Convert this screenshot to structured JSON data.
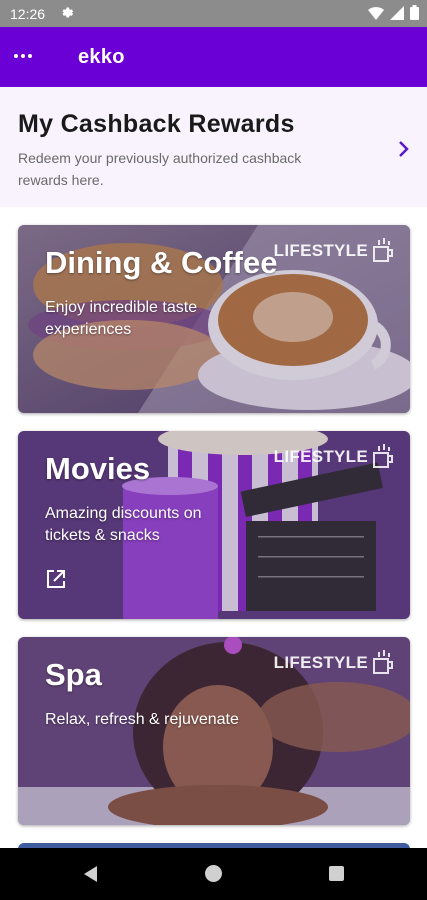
{
  "status_bar": {
    "time": "12:26",
    "icons": [
      "gear-icon",
      "wifi-icon",
      "signal-icon",
      "battery-icon"
    ]
  },
  "app_bar": {
    "title": "ekko",
    "menu_icon": "more-horizontal-icon",
    "color": "#6b00d6"
  },
  "cashback": {
    "title": "My Cashback Rewards",
    "description": "Redeem your previously authorized cashback rewards here.",
    "chevron_icon": "chevron-right-icon",
    "accent": "#5a18c9"
  },
  "cards": [
    {
      "title": "Dining & Coffee",
      "subtitle": "Enjoy incredible taste experiences",
      "badge": "LIFESTYLE"
    },
    {
      "title": "Movies",
      "subtitle": "Amazing discounts on tickets & snacks",
      "badge": "LIFESTYLE",
      "icon": "external-link-icon"
    },
    {
      "title": "Spa",
      "subtitle": "Relax, refresh & rejuvenate",
      "badge": "LIFESTYLE"
    }
  ],
  "nav_bar": {
    "icons": [
      "back-icon",
      "home-icon",
      "recents-icon"
    ]
  }
}
